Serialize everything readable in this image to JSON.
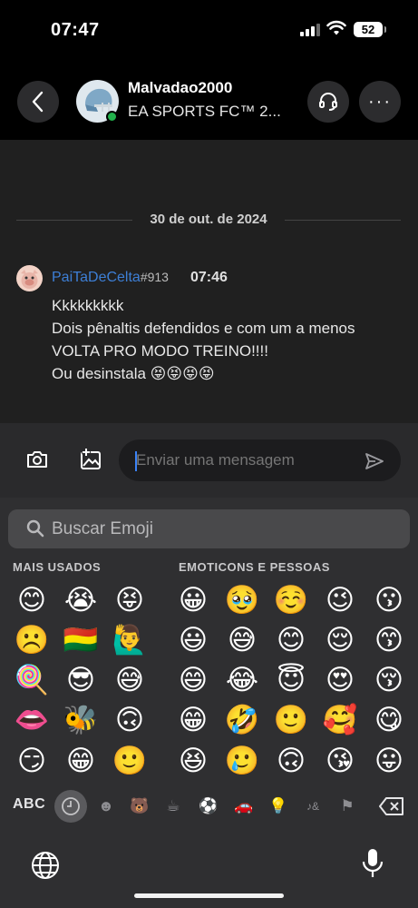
{
  "status": {
    "time": "07:47",
    "battery": "52"
  },
  "header": {
    "contact_name": "Malvadao2000",
    "game": "EA SPORTS FC™ 2...",
    "status_color": "#22b14c"
  },
  "chat": {
    "date": "30 de out. de 2024",
    "message": {
      "username": "PaiTaDeCelta",
      "tag": "#913",
      "time": "07:46",
      "lines": [
        "Kkkkkkkkk",
        "Dois pênaltis defendidos e com um a menos",
        "VOLTA PRO MODO TREINO!!!!",
        "Ou desinstala 😝😝😝😝"
      ]
    }
  },
  "composer": {
    "placeholder": "Enviar uma mensagem"
  },
  "emoji_keyboard": {
    "search_placeholder": "Buscar Emoji",
    "most_used_label": "MAIS USADOS",
    "smileys_label": "EMOTICONS E PESSOAS",
    "abc_label": "ABC",
    "most_used": [
      "😊",
      "😭",
      "😝",
      "☹️",
      "🇧🇴",
      "🙋‍♂️",
      "🍭",
      "😎",
      "😅",
      "👄",
      "🐝",
      "🙃",
      "😏",
      "😁",
      "🙂"
    ],
    "smileys": [
      "😀",
      "🥹",
      "☺️",
      "😉",
      "😗",
      "😃",
      "😅",
      "😊",
      "😌",
      "😙",
      "😄",
      "😂",
      "😇",
      "😍",
      "😚",
      "😁",
      "🤣",
      "🙂",
      "🥰",
      "😋",
      "😆",
      "🥲",
      "🙃",
      "😘",
      "😛"
    ],
    "categories": [
      "recent-icon",
      "smiley-icon",
      "animal-icon",
      "food-icon",
      "ball-icon",
      "vehicle-icon",
      "bulb-icon",
      "symbols-icon",
      "flag-icon"
    ]
  }
}
